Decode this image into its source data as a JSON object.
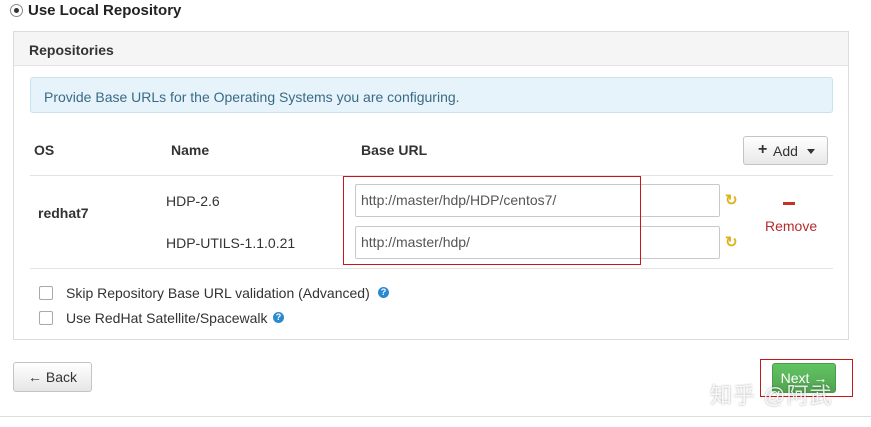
{
  "repo_option": {
    "label": "Use Local Repository",
    "selected": true
  },
  "panel": {
    "title": "Repositories",
    "info": "Provide Base URLs for the Operating Systems you are configuring.",
    "columns": {
      "os": "OS",
      "name": "Name",
      "base_url": "Base URL"
    },
    "add_button": {
      "label": "Add",
      "icon": "plus-icon"
    },
    "os_group": {
      "os": "redhat7",
      "repos": [
        {
          "name": "HDP-2.6",
          "url": "http://master/hdp/HDP/centos7/"
        },
        {
          "name": "HDP-UTILS-1.1.0.21",
          "url": "http://master/hdp/"
        }
      ],
      "remove_label": "Remove"
    },
    "options": [
      {
        "label": "Skip Repository Base URL validation (Advanced)",
        "checked": false
      },
      {
        "label": "Use RedHat Satellite/Spacewalk",
        "checked": false
      }
    ]
  },
  "nav": {
    "back": "← Back",
    "next": "Next →"
  },
  "watermark": "知乎 @阿武",
  "colors": {
    "accent_green": "#51a351",
    "remove_red": "#b72b2b",
    "highlight_box": "#c8161d",
    "info_bg": "#e6f3fa"
  }
}
